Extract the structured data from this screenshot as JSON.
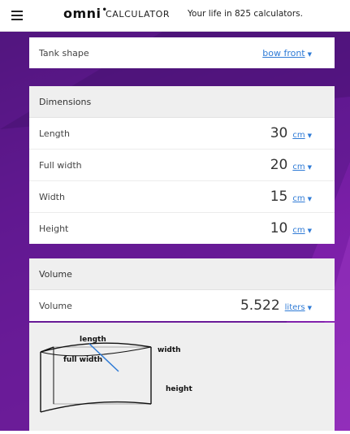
{
  "header": {
    "logo": "omni",
    "logo_suffix": "CALCULATOR",
    "tagline": "Your life in 825 calculators."
  },
  "tank_shape": {
    "label": "Tank shape",
    "value": "bow front"
  },
  "dimensions": {
    "title": "Dimensions",
    "rows": [
      {
        "label": "Length",
        "value": "30",
        "unit": "cm"
      },
      {
        "label": "Full width",
        "value": "20",
        "unit": "cm"
      },
      {
        "label": "Width",
        "value": "15",
        "unit": "cm"
      },
      {
        "label": "Height",
        "value": "10",
        "unit": "cm"
      }
    ]
  },
  "volume": {
    "title": "Volume",
    "label": "Volume",
    "value": "5.522",
    "unit": "liters"
  },
  "diagram": {
    "labels": {
      "length": "length",
      "full_width": "full width",
      "width": "width",
      "height": "height"
    }
  },
  "caret": "▼",
  "colors": {
    "accent": "#2f7bd6",
    "purple": "#6a1a9a"
  }
}
